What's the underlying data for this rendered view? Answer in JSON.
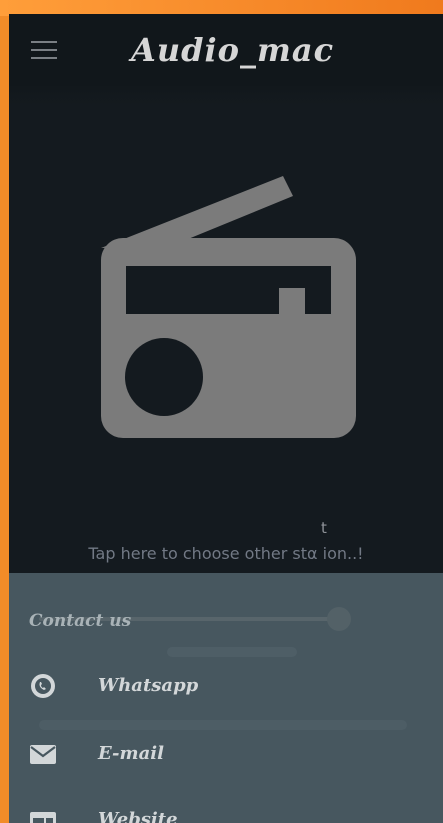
{
  "app": {
    "title": "Audio_mac"
  },
  "player": {
    "hint_stub": "t",
    "hint": "Tap here to choose other stα ion..!"
  },
  "contact": {
    "heading": "Contact us",
    "items": [
      {
        "label": "Whatsapp",
        "icon": "whatsapp-icon"
      },
      {
        "label": "E-mail",
        "icon": "email-icon"
      },
      {
        "label": "Website",
        "icon": "website-icon"
      }
    ]
  },
  "colors": {
    "frame": "#f28c28",
    "background": "#141a1f",
    "radio_icon": "#7b7b7b",
    "panel": "#47575f"
  }
}
